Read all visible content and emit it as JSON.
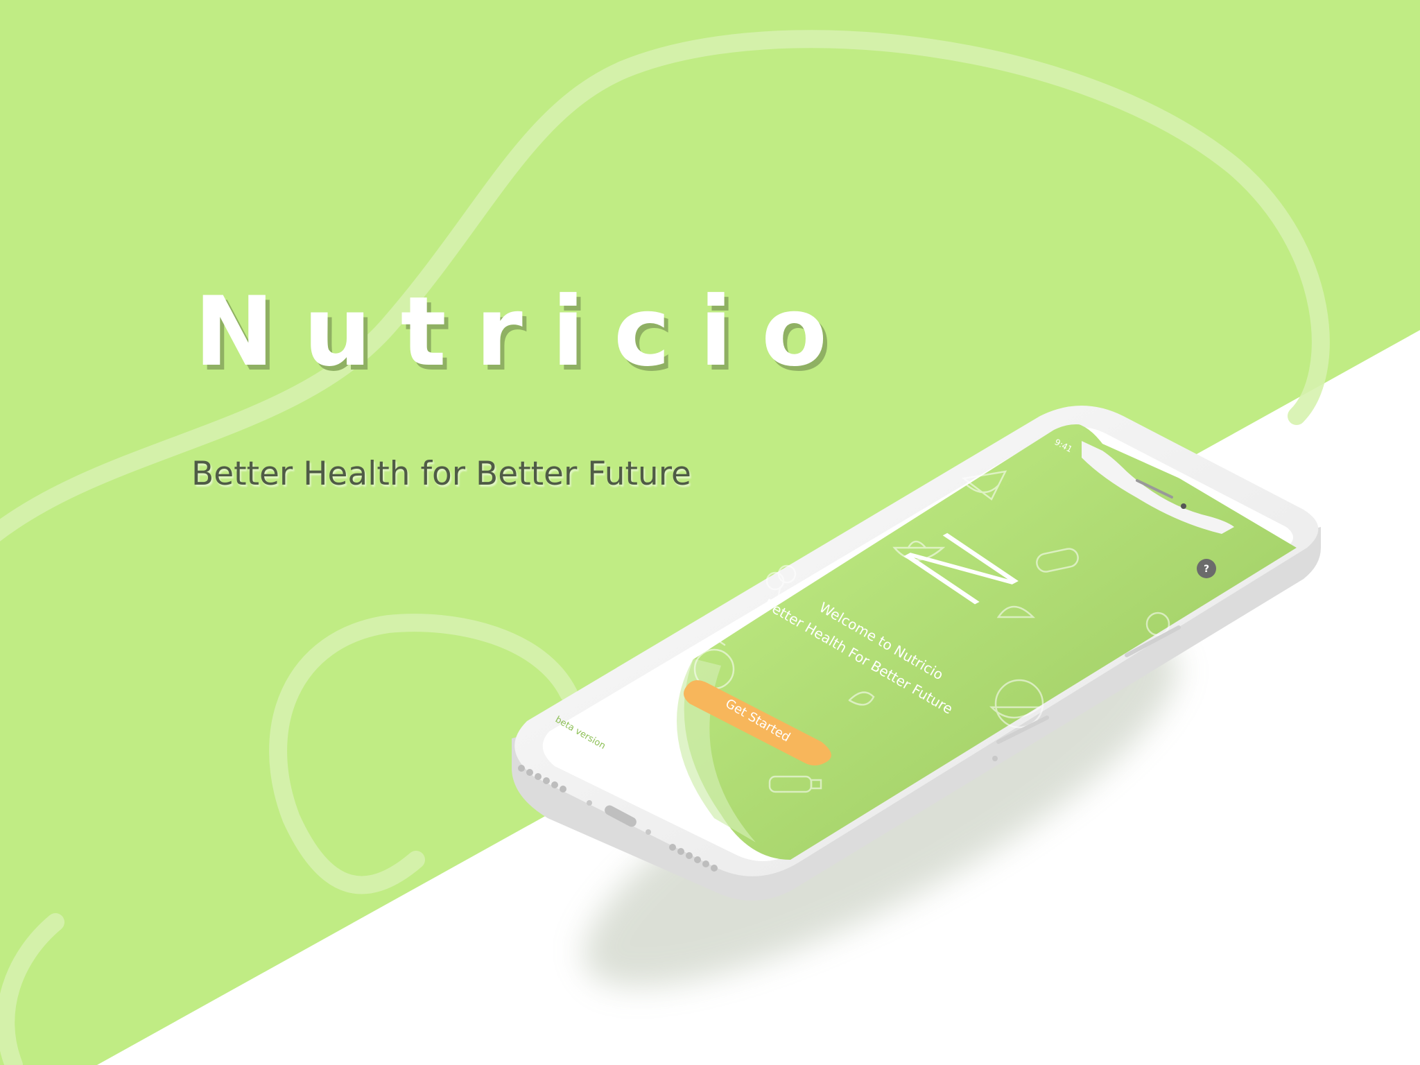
{
  "colors": {
    "background_green": "#c0ec84",
    "floor_white": "#ffffff",
    "accent_orange": "#f7b65b",
    "screen_green": "#a6d36c",
    "title_shadow": "#8fb063",
    "tagline_text": "#4f5b46"
  },
  "hero": {
    "title": "Nutricio",
    "tagline": "Better Health for Better Future"
  },
  "phone": {
    "status_time": "9:41",
    "help_icon_glyph": "?",
    "logo_letter": "N",
    "welcome_line1": "Welcome to Nutricio",
    "welcome_line2": "Better Health For Better Future",
    "cta_label": "Get Started",
    "beta_label": "beta version",
    "food_icons": [
      "pizza-icon",
      "bowl-icon",
      "burrito-icon",
      "coconut-icon",
      "broccoli-icon",
      "bottle-icon",
      "noodle-icon",
      "taco-icon"
    ]
  }
}
